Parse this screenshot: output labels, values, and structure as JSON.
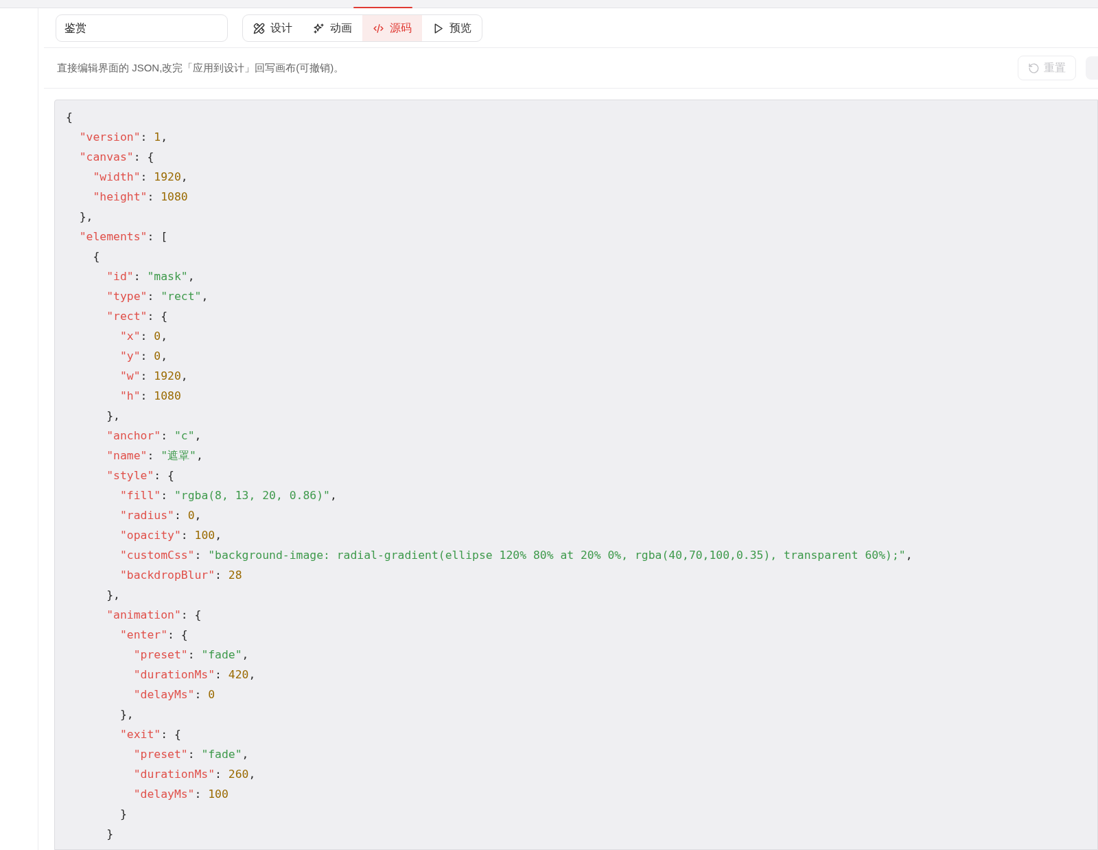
{
  "header": {
    "name_field": {
      "value": "鉴赏"
    },
    "tabs": [
      {
        "kind": "design",
        "label": "设计",
        "selected": false
      },
      {
        "kind": "animation",
        "label": "动画",
        "selected": false
      },
      {
        "kind": "source",
        "label": "源码",
        "selected": true
      },
      {
        "kind": "preview",
        "label": "预览",
        "selected": false
      }
    ]
  },
  "toolbar": {
    "description": "直接编辑界面的 JSON,改完「应用到设计」回写画布(可撤销)。",
    "reset_button": {
      "label": "重置",
      "disabled": true
    }
  },
  "code_editor": {
    "lines": [
      [
        {
          "kind": "punct",
          "text": "{"
        }
      ],
      [
        {
          "kind": "key",
          "text": "  \"version\""
        },
        {
          "kind": "punct",
          "text": ": "
        },
        {
          "kind": "number",
          "text": "1"
        },
        {
          "kind": "punct",
          "text": ","
        }
      ],
      [
        {
          "kind": "key",
          "text": "  \"canvas\""
        },
        {
          "kind": "punct",
          "text": ": {"
        }
      ],
      [
        {
          "kind": "key",
          "text": "    \"width\""
        },
        {
          "kind": "punct",
          "text": ": "
        },
        {
          "kind": "number",
          "text": "1920"
        },
        {
          "kind": "punct",
          "text": ","
        }
      ],
      [
        {
          "kind": "key",
          "text": "    \"height\""
        },
        {
          "kind": "punct",
          "text": ": "
        },
        {
          "kind": "number",
          "text": "1080"
        }
      ],
      [
        {
          "kind": "punct",
          "text": "  },"
        }
      ],
      [
        {
          "kind": "key",
          "text": "  \"elements\""
        },
        {
          "kind": "punct",
          "text": ": ["
        }
      ],
      [
        {
          "kind": "punct",
          "text": "    {"
        }
      ],
      [
        {
          "kind": "key",
          "text": "      \"id\""
        },
        {
          "kind": "punct",
          "text": ": "
        },
        {
          "kind": "string",
          "text": "\"mask\""
        },
        {
          "kind": "punct",
          "text": ","
        }
      ],
      [
        {
          "kind": "key",
          "text": "      \"type\""
        },
        {
          "kind": "punct",
          "text": ": "
        },
        {
          "kind": "string",
          "text": "\"rect\""
        },
        {
          "kind": "punct",
          "text": ","
        }
      ],
      [
        {
          "kind": "key",
          "text": "      \"rect\""
        },
        {
          "kind": "punct",
          "text": ": {"
        }
      ],
      [
        {
          "kind": "key",
          "text": "        \"x\""
        },
        {
          "kind": "punct",
          "text": ": "
        },
        {
          "kind": "number",
          "text": "0"
        },
        {
          "kind": "punct",
          "text": ","
        }
      ],
      [
        {
          "kind": "key",
          "text": "        \"y\""
        },
        {
          "kind": "punct",
          "text": ": "
        },
        {
          "kind": "number",
          "text": "0"
        },
        {
          "kind": "punct",
          "text": ","
        }
      ],
      [
        {
          "kind": "key",
          "text": "        \"w\""
        },
        {
          "kind": "punct",
          "text": ": "
        },
        {
          "kind": "number",
          "text": "1920"
        },
        {
          "kind": "punct",
          "text": ","
        }
      ],
      [
        {
          "kind": "key",
          "text": "        \"h\""
        },
        {
          "kind": "punct",
          "text": ": "
        },
        {
          "kind": "number",
          "text": "1080"
        }
      ],
      [
        {
          "kind": "punct",
          "text": "      },"
        }
      ],
      [
        {
          "kind": "key",
          "text": "      \"anchor\""
        },
        {
          "kind": "punct",
          "text": ": "
        },
        {
          "kind": "string",
          "text": "\"c\""
        },
        {
          "kind": "punct",
          "text": ","
        }
      ],
      [
        {
          "kind": "key",
          "text": "      \"name\""
        },
        {
          "kind": "punct",
          "text": ": "
        },
        {
          "kind": "string",
          "text": "\"遮罩\""
        },
        {
          "kind": "punct",
          "text": ","
        }
      ],
      [
        {
          "kind": "key",
          "text": "      \"style\""
        },
        {
          "kind": "punct",
          "text": ": {"
        }
      ],
      [
        {
          "kind": "key",
          "text": "        \"fill\""
        },
        {
          "kind": "punct",
          "text": ": "
        },
        {
          "kind": "string",
          "text": "\"rgba(8, 13, 20, 0.86)\""
        },
        {
          "kind": "punct",
          "text": ","
        }
      ],
      [
        {
          "kind": "key",
          "text": "        \"radius\""
        },
        {
          "kind": "punct",
          "text": ": "
        },
        {
          "kind": "number",
          "text": "0"
        },
        {
          "kind": "punct",
          "text": ","
        }
      ],
      [
        {
          "kind": "key",
          "text": "        \"opacity\""
        },
        {
          "kind": "punct",
          "text": ": "
        },
        {
          "kind": "number",
          "text": "100"
        },
        {
          "kind": "punct",
          "text": ","
        }
      ],
      [
        {
          "kind": "key",
          "text": "        \"customCss\""
        },
        {
          "kind": "punct",
          "text": ": "
        },
        {
          "kind": "string",
          "text": "\"background-image: radial-gradient(ellipse 120% 80% at 20% 0%, rgba(40,70,100,0.35), transparent 60%);\""
        },
        {
          "kind": "punct",
          "text": ","
        }
      ],
      [
        {
          "kind": "key",
          "text": "        \"backdropBlur\""
        },
        {
          "kind": "punct",
          "text": ": "
        },
        {
          "kind": "number",
          "text": "28"
        }
      ],
      [
        {
          "kind": "punct",
          "text": "      },"
        }
      ],
      [
        {
          "kind": "key",
          "text": "      \"animation\""
        },
        {
          "kind": "punct",
          "text": ": {"
        }
      ],
      [
        {
          "kind": "key",
          "text": "        \"enter\""
        },
        {
          "kind": "punct",
          "text": ": {"
        }
      ],
      [
        {
          "kind": "key",
          "text": "          \"preset\""
        },
        {
          "kind": "punct",
          "text": ": "
        },
        {
          "kind": "string",
          "text": "\"fade\""
        },
        {
          "kind": "punct",
          "text": ","
        }
      ],
      [
        {
          "kind": "key",
          "text": "          \"durationMs\""
        },
        {
          "kind": "punct",
          "text": ": "
        },
        {
          "kind": "number",
          "text": "420"
        },
        {
          "kind": "punct",
          "text": ","
        }
      ],
      [
        {
          "kind": "key",
          "text": "          \"delayMs\""
        },
        {
          "kind": "punct",
          "text": ": "
        },
        {
          "kind": "number",
          "text": "0"
        }
      ],
      [
        {
          "kind": "punct",
          "text": "        },"
        }
      ],
      [
        {
          "kind": "key",
          "text": "        \"exit\""
        },
        {
          "kind": "punct",
          "text": ": {"
        }
      ],
      [
        {
          "kind": "key",
          "text": "          \"preset\""
        },
        {
          "kind": "punct",
          "text": ": "
        },
        {
          "kind": "string",
          "text": "\"fade\""
        },
        {
          "kind": "punct",
          "text": ","
        }
      ],
      [
        {
          "kind": "key",
          "text": "          \"durationMs\""
        },
        {
          "kind": "punct",
          "text": ": "
        },
        {
          "kind": "number",
          "text": "260"
        },
        {
          "kind": "punct",
          "text": ","
        }
      ],
      [
        {
          "kind": "key",
          "text": "          \"delayMs\""
        },
        {
          "kind": "punct",
          "text": ": "
        },
        {
          "kind": "number",
          "text": "100"
        }
      ],
      [
        {
          "kind": "punct",
          "text": "        }"
        }
      ],
      [
        {
          "kind": "punct",
          "text": "      }"
        }
      ]
    ]
  }
}
